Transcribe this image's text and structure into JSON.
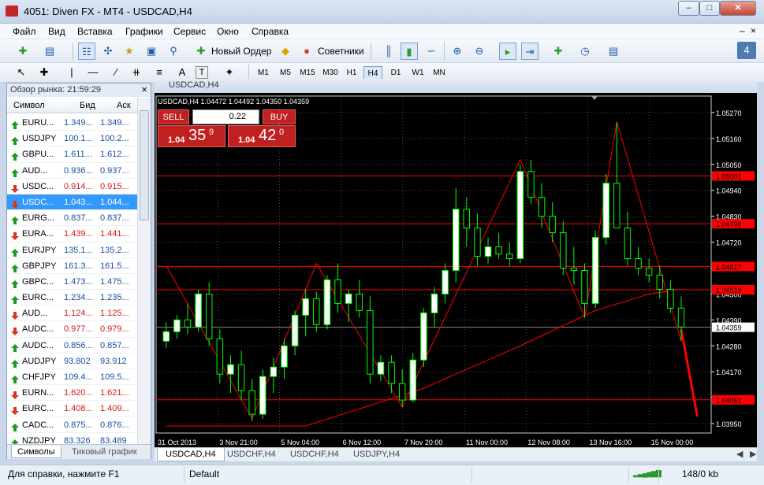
{
  "window": {
    "title": "4051: Diven FX - MT4 - USDCAD,H4"
  },
  "menu": [
    "Файл",
    "Вид",
    "Вставка",
    "Графики",
    "Сервис",
    "Окно",
    "Справка"
  ],
  "toolbar": {
    "new_order": "Новый Ордер",
    "experts": "Советники",
    "badge": "4"
  },
  "tools": {
    "text_tool": "A",
    "label_tool": "T"
  },
  "timeframes": [
    "M1",
    "M5",
    "M15",
    "M30",
    "H1",
    "H4",
    "D1",
    "W1",
    "MN"
  ],
  "market_watch": {
    "title": "Обзор рынка: 21:59:29",
    "col_symbol": "Символ",
    "col_bid": "Бид",
    "col_ask": "Аск",
    "rows": [
      {
        "symbol": "EURU...",
        "bid": "1.349...",
        "ask": "1.349...",
        "dir": "up"
      },
      {
        "symbol": "USDJPY",
        "bid": "100.1...",
        "ask": "100.2...",
        "dir": "up"
      },
      {
        "symbol": "GBPU...",
        "bid": "1.611...",
        "ask": "1.612...",
        "dir": "up"
      },
      {
        "symbol": "AUD...",
        "bid": "0.936...",
        "ask": "0.937...",
        "dir": "up"
      },
      {
        "symbol": "USDC...",
        "bid": "0.914...",
        "ask": "0.915...",
        "dir": "down"
      },
      {
        "symbol": "USDC...",
        "bid": "1.043...",
        "ask": "1.044...",
        "dir": "down",
        "selected": true
      },
      {
        "symbol": "EURG...",
        "bid": "0.837...",
        "ask": "0.837...",
        "dir": "up"
      },
      {
        "symbol": "EURA...",
        "bid": "1.439...",
        "ask": "1.441...",
        "dir": "down"
      },
      {
        "symbol": "EURJPY",
        "bid": "135.1...",
        "ask": "135.2...",
        "dir": "up"
      },
      {
        "symbol": "GBPJPY",
        "bid": "161.3...",
        "ask": "161.5...",
        "dir": "up"
      },
      {
        "symbol": "GBPC...",
        "bid": "1.473...",
        "ask": "1.475...",
        "dir": "up"
      },
      {
        "symbol": "EURC...",
        "bid": "1.234...",
        "ask": "1.235...",
        "dir": "up"
      },
      {
        "symbol": "AUD...",
        "bid": "1.124...",
        "ask": "1.125...",
        "dir": "down"
      },
      {
        "symbol": "AUDC...",
        "bid": "0.977...",
        "ask": "0.979...",
        "dir": "down"
      },
      {
        "symbol": "AUDC...",
        "bid": "0.856...",
        "ask": "0.857...",
        "dir": "up"
      },
      {
        "symbol": "AUDJPY",
        "bid": "93.802",
        "ask": "93.912",
        "dir": "up"
      },
      {
        "symbol": "CHFJPY",
        "bid": "109.4...",
        "ask": "109.5...",
        "dir": "up"
      },
      {
        "symbol": "EURN...",
        "bid": "1.620...",
        "ask": "1.621...",
        "dir": "down"
      },
      {
        "symbol": "EURC...",
        "bid": "1.408...",
        "ask": "1.409...",
        "dir": "down"
      },
      {
        "symbol": "CADC...",
        "bid": "0.875...",
        "ask": "0.876...",
        "dir": "up"
      },
      {
        "symbol": "NZDJPY",
        "bid": "83.326",
        "ask": "83.489",
        "dir": "up"
      }
    ],
    "tabs": [
      "Символы",
      "Тиковый график"
    ]
  },
  "chart": {
    "window_title": "USDCAD,H4",
    "info": "USDCAD,H4  1.04472 1.04492 1.04350 1.04359",
    "one_click": {
      "sell": "SELL",
      "buy": "BUY",
      "lot": "0.22",
      "sell_prefix": "1.04",
      "sell_big": "35",
      "sell_sup": "9",
      "buy_prefix": "1.04",
      "buy_big": "42",
      "buy_sup": "0"
    },
    "tabs": [
      "USDCAD,H4",
      "USDCHF,H4",
      "USDCHF,H4",
      "USDJPY,H4"
    ],
    "colors": {
      "bull": "#00ff00",
      "bear": "#00ff00",
      "bull_fill": "#ffffff",
      "level": "#ff0000",
      "background": "#000000",
      "grid": "#4a4a4a",
      "ma": "#ff0000",
      "zigzag": "#ff0000"
    }
  },
  "chart_data": {
    "type": "candlestick",
    "title": "USDCAD,H4",
    "ylim": [
      1.0391,
      1.0534
    ],
    "y_ticks": [
      "1.05270",
      "1.05160",
      "1.05050",
      "1.04940",
      "1.04830",
      "1.04720",
      "1.04610",
      "1.04500",
      "1.04390",
      "1.04280",
      "1.04170",
      "1.04060",
      "1.03950"
    ],
    "x_ticks": [
      "31 Oct 2013",
      "3 Nov 21:00",
      "5 Nov 04:00",
      "6 Nov 12:00",
      "7 Nov 20:00",
      "11 Nov 00:00",
      "12 Nov 08:00",
      "13 Nov 16:00",
      "15 Nov 00:00"
    ],
    "levels": [
      {
        "value": 1.05001,
        "label": "1.05001"
      },
      {
        "value": 1.04798,
        "label": "1.04798"
      },
      {
        "value": 1.04617,
        "label": "1.04617"
      },
      {
        "value": 1.04518,
        "label": "1.04518"
      },
      {
        "value": 1.04051,
        "label": "1.04051"
      }
    ],
    "current_price": {
      "value": 1.04359,
      "label": "1.04359"
    },
    "candles": [
      [
        1.043,
        1.0438,
        1.0427,
        1.0434
      ],
      [
        1.0434,
        1.0441,
        1.0431,
        1.0439
      ],
      [
        1.0439,
        1.0446,
        1.0433,
        1.0436
      ],
      [
        1.0436,
        1.0452,
        1.0434,
        1.045
      ],
      [
        1.045,
        1.0455,
        1.0428,
        1.0431
      ],
      [
        1.0431,
        1.0435,
        1.0412,
        1.0416
      ],
      [
        1.0416,
        1.0424,
        1.0408,
        1.042
      ],
      [
        1.042,
        1.0426,
        1.0405,
        1.0409
      ],
      [
        1.0409,
        1.0414,
        1.0396,
        1.0399
      ],
      [
        1.0399,
        1.0418,
        1.0397,
        1.0415
      ],
      [
        1.0415,
        1.0423,
        1.0408,
        1.0419
      ],
      [
        1.0419,
        1.0431,
        1.0414,
        1.0428
      ],
      [
        1.0428,
        1.0443,
        1.0424,
        1.0441
      ],
      [
        1.0441,
        1.0452,
        1.0432,
        1.0448
      ],
      [
        1.0448,
        1.0451,
        1.0434,
        1.0437
      ],
      [
        1.0437,
        1.0458,
        1.0435,
        1.0456
      ],
      [
        1.0456,
        1.0463,
        1.0442,
        1.0446
      ],
      [
        1.0446,
        1.0452,
        1.0438,
        1.045
      ],
      [
        1.045,
        1.0456,
        1.044,
        1.0443
      ],
      [
        1.0443,
        1.0449,
        1.0412,
        1.0416
      ],
      [
        1.0416,
        1.0424,
        1.0413,
        1.0421
      ],
      [
        1.0421,
        1.0424,
        1.0408,
        1.0412
      ],
      [
        1.0412,
        1.0418,
        1.0402,
        1.0405
      ],
      [
        1.0405,
        1.0425,
        1.0404,
        1.0422
      ],
      [
        1.0422,
        1.0444,
        1.0419,
        1.0442
      ],
      [
        1.0442,
        1.0453,
        1.0436,
        1.045
      ],
      [
        1.045,
        1.0463,
        1.0446,
        1.046
      ],
      [
        1.046,
        1.0495,
        1.0455,
        1.0486
      ],
      [
        1.0486,
        1.0491,
        1.047,
        1.0478
      ],
      [
        1.0478,
        1.0484,
        1.0462,
        1.0466
      ],
      [
        1.0466,
        1.0474,
        1.0463,
        1.047
      ],
      [
        1.047,
        1.0476,
        1.0465,
        1.0467
      ],
      [
        1.0467,
        1.0472,
        1.0462,
        1.0465
      ],
      [
        1.0465,
        1.0505,
        1.0463,
        1.0502
      ],
      [
        1.0502,
        1.0507,
        1.0488,
        1.0491
      ],
      [
        1.0491,
        1.0497,
        1.0478,
        1.0483
      ],
      [
        1.0483,
        1.0489,
        1.0472,
        1.0476
      ],
      [
        1.0476,
        1.0481,
        1.0458,
        1.0461
      ],
      [
        1.0461,
        1.047,
        1.0454,
        1.046
      ],
      [
        1.046,
        1.0463,
        1.044,
        1.0446
      ],
      [
        1.0446,
        1.0477,
        1.0444,
        1.0474
      ],
      [
        1.0474,
        1.0501,
        1.0471,
        1.0497
      ],
      [
        1.0497,
        1.0523,
        1.049,
        1.0478
      ],
      [
        1.0478,
        1.0485,
        1.0462,
        1.0465
      ],
      [
        1.0465,
        1.047,
        1.0458,
        1.0461
      ],
      [
        1.0461,
        1.0465,
        1.0455,
        1.0458
      ],
      [
        1.0458,
        1.0462,
        1.0448,
        1.0452
      ],
      [
        1.0452,
        1.0456,
        1.0442,
        1.0444
      ],
      [
        1.0444,
        1.0449,
        1.043,
        1.0436
      ]
    ],
    "ma": [
      [
        0,
        1.0394
      ],
      [
        13,
        1.0394
      ],
      [
        24,
        1.041
      ],
      [
        33,
        1.0428
      ],
      [
        40,
        1.0443
      ],
      [
        45,
        1.045
      ],
      [
        48,
        1.0452
      ]
    ],
    "zigzag": [
      [
        0,
        1.0462
      ],
      [
        8,
        1.0397
      ],
      [
        14,
        1.0463
      ],
      [
        22,
        1.0402
      ],
      [
        33,
        1.0507
      ],
      [
        39,
        1.044
      ],
      [
        42,
        1.0523
      ],
      [
        48,
        1.043
      ]
    ],
    "projection": [
      [
        48,
        1.0435
      ],
      [
        49.5,
        1.0398
      ]
    ]
  },
  "status": {
    "help": "Для справки, нажмите F1",
    "profile": "Default",
    "traffic": "148/0 kb"
  }
}
